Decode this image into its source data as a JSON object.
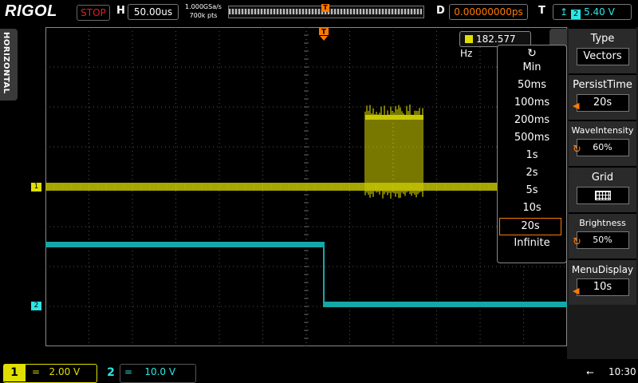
{
  "top": {
    "brand": "RIGOL",
    "run_state": "STOP",
    "h_label": "H",
    "timebase": "50.00us",
    "sample_rate": "1.000GSa/s",
    "memory_depth": "700k pts",
    "trigger_marker": "T",
    "d_label": "D",
    "delay": "0.00000000ps",
    "t_label": "T",
    "trigger_source": "2",
    "trigger_level": "5.40 V",
    "trigger_edge_icon": "rising-edge-icon"
  },
  "side_tab": {
    "label": "HORIZONTAL"
  },
  "screen": {
    "frequency": "182.577 Hz",
    "ch1_marker": "1",
    "ch2_marker": "2",
    "ch1_color": "#e0e000",
    "ch2_color": "#2ee6e6",
    "trigger_color": "#ff7a00"
  },
  "persist_list": {
    "icon": "rotate-knob-icon",
    "options": [
      "Min",
      "50ms",
      "100ms",
      "200ms",
      "500ms",
      "1s",
      "2s",
      "5s",
      "10s",
      "20s",
      "Infinite"
    ],
    "selected": "20s"
  },
  "menu": {
    "type_title": "Type",
    "type_value": "Vectors",
    "persist_title": "PersistTime",
    "persist_value": "20s",
    "intensity_title": "WaveIntensity",
    "intensity_value": "60%",
    "grid_title": "Grid",
    "brightness_title": "Brightness",
    "brightness_value": "50%",
    "menudisplay_title": "MenuDisplay",
    "menudisplay_value": "10s"
  },
  "bottom": {
    "ch1_num": "1",
    "ch1_coupling": "=",
    "ch1_scale": "2.00 V",
    "ch2_num": "2",
    "ch2_coupling": "=",
    "ch2_scale": "10.0 V",
    "usb_icon": "usb-icon",
    "time": "10:30"
  }
}
